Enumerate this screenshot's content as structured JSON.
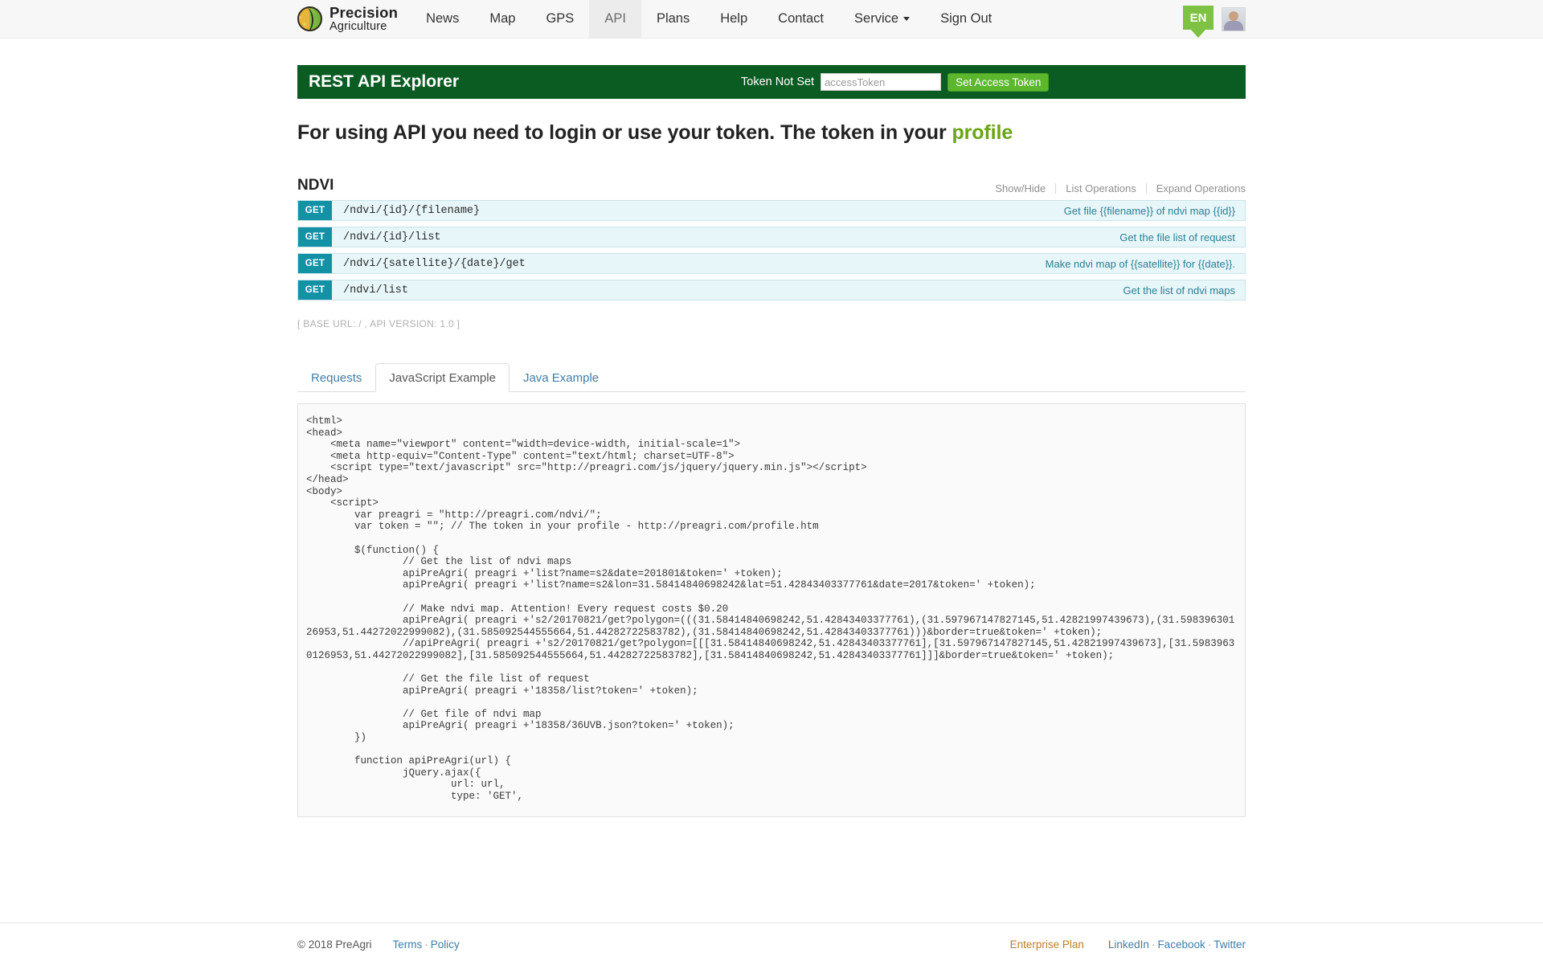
{
  "nav": {
    "brand": {
      "line1": "Precision",
      "line2": "Agriculture",
      "logo_icon": "leaf-circle-logo"
    },
    "items": [
      {
        "label": "News",
        "active": false
      },
      {
        "label": "Map",
        "active": false
      },
      {
        "label": "GPS",
        "active": false
      },
      {
        "label": "API",
        "active": true
      },
      {
        "label": "Plans",
        "active": false
      },
      {
        "label": "Help",
        "active": false
      },
      {
        "label": "Contact",
        "active": false
      },
      {
        "label": "Service",
        "active": false,
        "caret": true
      },
      {
        "label": "Sign Out",
        "active": false
      }
    ],
    "language": "EN",
    "avatar_icon": "user-avatar"
  },
  "api_bar": {
    "title": "REST API Explorer",
    "token_status": "Token Not Set",
    "token_value": "",
    "token_placeholder": "accessToken",
    "set_token_label": "Set Access Token"
  },
  "headline": {
    "text_before": "For using API you need to login or use your token. The token in your ",
    "link": "profile"
  },
  "resource": {
    "title": "NDVI",
    "actions": [
      "Show/Hide",
      "List Operations",
      "Expand Operations"
    ],
    "operations": [
      {
        "method": "GET",
        "path": "/ndvi/{id}/{filename}",
        "description": "Get file {{filename}} of ndvi map {{id}}"
      },
      {
        "method": "GET",
        "path": "/ndvi/{id}/list",
        "description": "Get the file list of request"
      },
      {
        "method": "GET",
        "path": "/ndvi/{satellite}/{date}/get",
        "description": "Make ndvi map of {{satellite}} for {{date}}."
      },
      {
        "method": "GET",
        "path": "/ndvi/list",
        "description": "Get the list of ndvi maps"
      }
    ],
    "base_url_line": "[ BASE URL: / , API VERSION: 1.0 ]"
  },
  "tabs": [
    {
      "label": "Requests",
      "active": false
    },
    {
      "label": "JavaScript Example",
      "active": true
    },
    {
      "label": "Java Example",
      "active": false
    }
  ],
  "code": "<html>\n<head>\n    <meta name=\"viewport\" content=\"width=device-width, initial-scale=1\">\n    <meta http-equiv=\"Content-Type\" content=\"text/html; charset=UTF-8\">\n    <script type=\"text/javascript\" src=\"http://preagri.com/js/jquery/jquery.min.js\"></script>\n</head>\n<body>\n    <script>\n        var preagri = \"http://preagri.com/ndvi/\";\n        var token = \"\"; // The token in your profile - http://preagri.com/profile.htm\n\n        $(function() {\n                // Get the list of ndvi maps\n                apiPreAgri( preagri +'list?name=s2&date=201801&token=' +token);\n                apiPreAgri( preagri +'list?name=s2&lon=31.58414840698242&lat=51.42843403377761&date=2017&token=' +token);\n\n                // Make ndvi map. Attention! Every request costs $0.20\n                apiPreAgri( preagri +'s2/20170821/get?polygon=(((31.58414840698242,51.42843403377761),(31.597967147827145,51.42821997439673),(31.59839630126953,51.44272022999082),(31.585092544555664,51.44282722583782),(31.58414840698242,51.42843403377761)))&border=true&token=' +token);\n                //apiPreAgri( preagri +'s2/20170821/get?polygon=[[[31.58414840698242,51.42843403377761],[31.597967147827145,51.42821997439673],[31.59839630126953,51.44272022999082],[31.585092544555664,51.44282722583782],[31.58414840698242,51.42843403377761]]]&border=true&token=' +token);\n\n                // Get the file list of request\n                apiPreAgri( preagri +'18358/list?token=' +token);\n\n                // Get file of ndvi map\n                apiPreAgri( preagri +'18358/36UVB.json?token=' +token);\n        })\n\n        function apiPreAgri(url) {\n                jQuery.ajax({\n                        url: url,\n                        type: 'GET',",
  "footer": {
    "copyright": "© 2018 PreAgri",
    "links": [
      "Terms",
      "Policy"
    ],
    "enterprise": "Enterprise Plan",
    "social": [
      "LinkedIn",
      "Facebook",
      "Twitter"
    ]
  }
}
